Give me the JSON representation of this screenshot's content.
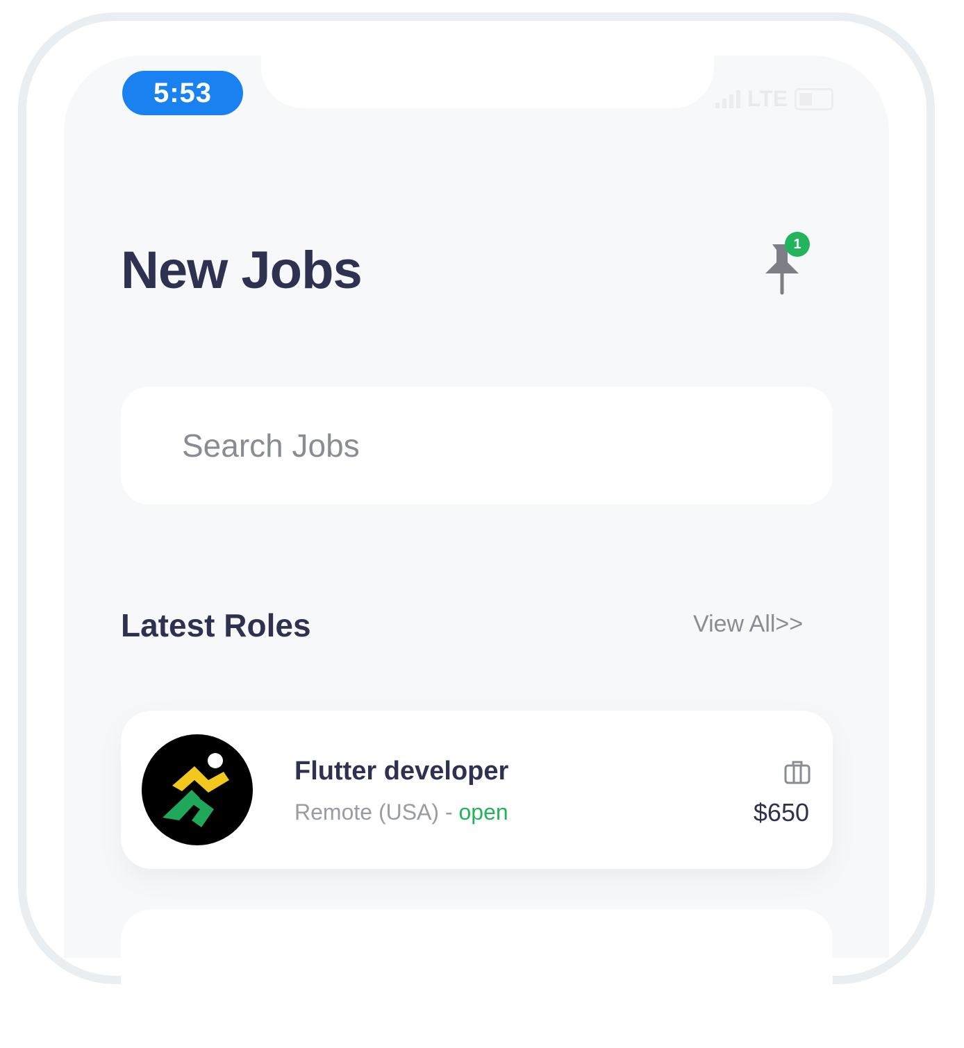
{
  "status_bar": {
    "time": "5:53",
    "network": "LTE"
  },
  "header": {
    "title": "New Jobs",
    "pinned_count": "1",
    "icon": "pin-icon"
  },
  "search": {
    "placeholder": "Search Jobs"
  },
  "latest_roles": {
    "title": "Latest Roles",
    "view_all": "View All>>",
    "jobs": [
      {
        "title": "Flutter developer",
        "location": "Remote (USA)",
        "separator": " - ",
        "status": "open",
        "salary": "$650",
        "icon": "briefcase-icon"
      }
    ]
  },
  "colors": {
    "accent": "#22b45a",
    "time_pill": "#1a82f0",
    "text_primary": "#2e3150",
    "text_secondary": "#8a8c94"
  }
}
